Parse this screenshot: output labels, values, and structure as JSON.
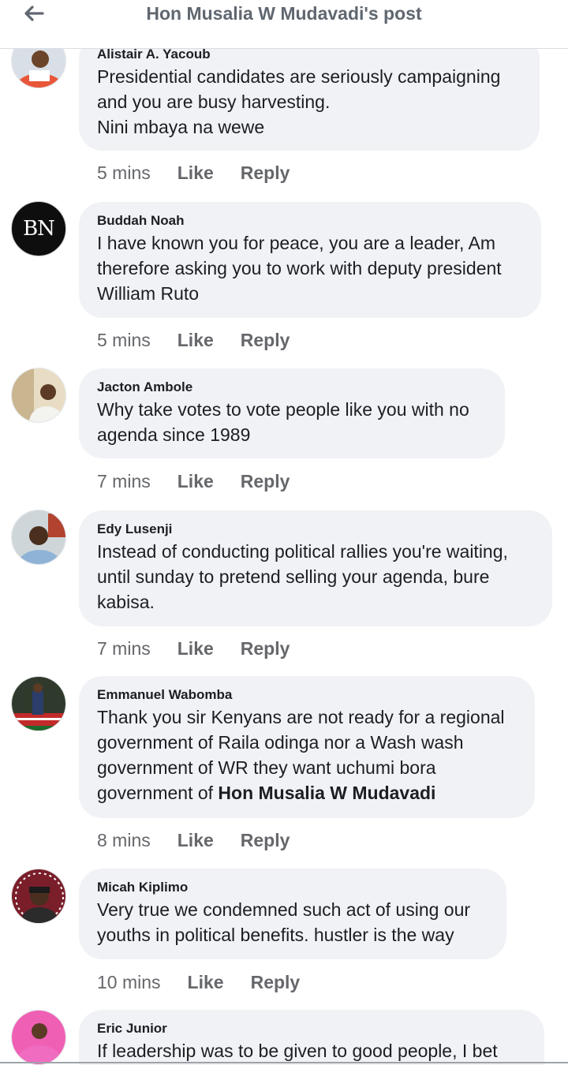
{
  "header": {
    "title": "Hon Musalia W Mudavadi's post"
  },
  "comments": [
    {
      "author": "Alistair A. Yacoub",
      "text": "Presidential candidates are seriously campaigning\nand you are busy harvesting.\nNini mbaya na wewe",
      "time": "5 mins",
      "like": "Like",
      "reply": "Reply"
    },
    {
      "author": "Buddah Noah",
      "avatar_text": "BN",
      "text": "I have known you for peace, you are a leader,  Am\ntherefore asking you to work with deputy president\nWilliam Ruto",
      "time": "5 mins",
      "like": "Like",
      "reply": "Reply"
    },
    {
      "author": "Jacton Ambole",
      "text": "Why take votes to vote people like you with no\nagenda since 1989",
      "time": "7 mins",
      "like": "Like",
      "reply": "Reply"
    },
    {
      "author": "Edy Lusenji",
      "text": "Instead of conducting political rallies you're waiting,\nuntil sunday to pretend selling your agenda, bure\nkabisa.",
      "time": "7 mins",
      "like": "Like",
      "reply": "Reply"
    },
    {
      "author": "Emmanuel Wabomba",
      "text": "Thank you sir Kenyans are not ready for a regional\ngovernment of Raila odinga nor a Wash  wash\ngovernment of WR they want uchumi bora\ngovernment of ",
      "mention": "Hon Musalia W Mudavadi",
      "time": "8 mins",
      "like": "Like",
      "reply": "Reply"
    },
    {
      "author": "Micah Kiplimo",
      "text": "Very true we condemned such act of using our\nyouths in political benefits.   hustler is the way",
      "time": "10 mins",
      "like": "Like",
      "reply": "Reply"
    },
    {
      "author": "Eric Junior",
      "text": "If leadership was to be given to good people, I bet"
    }
  ]
}
